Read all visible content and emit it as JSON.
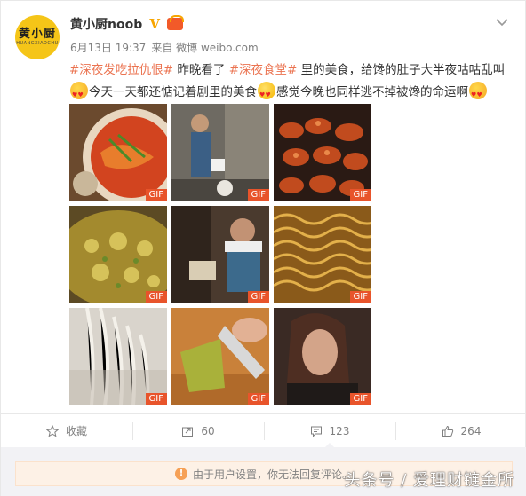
{
  "post": {
    "avatar_text": "黄小厨",
    "avatar_subtext": "HUANGXIAOCHU",
    "username": "黄小厨noob",
    "vip_mark": "V",
    "date": "6月13日 19:37",
    "source_label": "来自 微博 weibo.com",
    "text_parts": {
      "hashtag1": "#深夜发吃拉仇恨#",
      "t1": " 昨晚看了 ",
      "hashtag2": "#深夜食堂#",
      "t2": " 里的美食，给馋的肚子大半夜咕咕乱叫",
      "t3": "今天一天都还惦记着剧里的美食",
      "t4": "感觉今晚也同样逃不掉被馋的命运啊"
    },
    "images": [
      {
        "icon": "noodle-bowl",
        "badge": "GIF"
      },
      {
        "icon": "chef-cooking",
        "badge": "GIF"
      },
      {
        "icon": "braised-sausage",
        "badge": "GIF"
      },
      {
        "icon": "frying-oil",
        "badge": "GIF"
      },
      {
        "icon": "chef-towel",
        "badge": "GIF"
      },
      {
        "icon": "instant-noodles",
        "badge": "GIF"
      },
      {
        "icon": "noodle-strands",
        "badge": "GIF"
      },
      {
        "icon": "knife-chopping",
        "badge": "GIF"
      },
      {
        "icon": "woman-eating",
        "badge": "GIF"
      }
    ]
  },
  "actions": {
    "favorite_label": "收藏",
    "repost_count": "60",
    "comment_count": "123",
    "like_count": "264"
  },
  "notice": {
    "text": "由于用户设置，你无法回复评论。"
  },
  "watermark": "头条号 / 爱理财链金所",
  "colors": {
    "hashtag": "#eb7350",
    "gif_badge": "#e8542b",
    "avatar_bg": "#f5c518"
  }
}
